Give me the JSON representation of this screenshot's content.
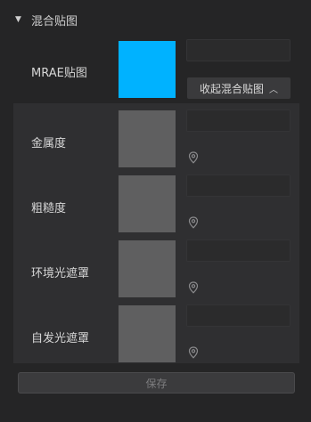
{
  "section": {
    "title": "混合贴图"
  },
  "mrae": {
    "label": "MRAE贴图",
    "color": "#00b2ff",
    "input_value": "",
    "collapse_label": "收起混合贴图"
  },
  "rows": [
    {
      "label": "金属度",
      "input_value": ""
    },
    {
      "label": "粗糙度",
      "input_value": ""
    },
    {
      "label": "环境光遮罩",
      "input_value": ""
    },
    {
      "label": "自发光遮罩",
      "input_value": ""
    }
  ],
  "save_label": "保存"
}
